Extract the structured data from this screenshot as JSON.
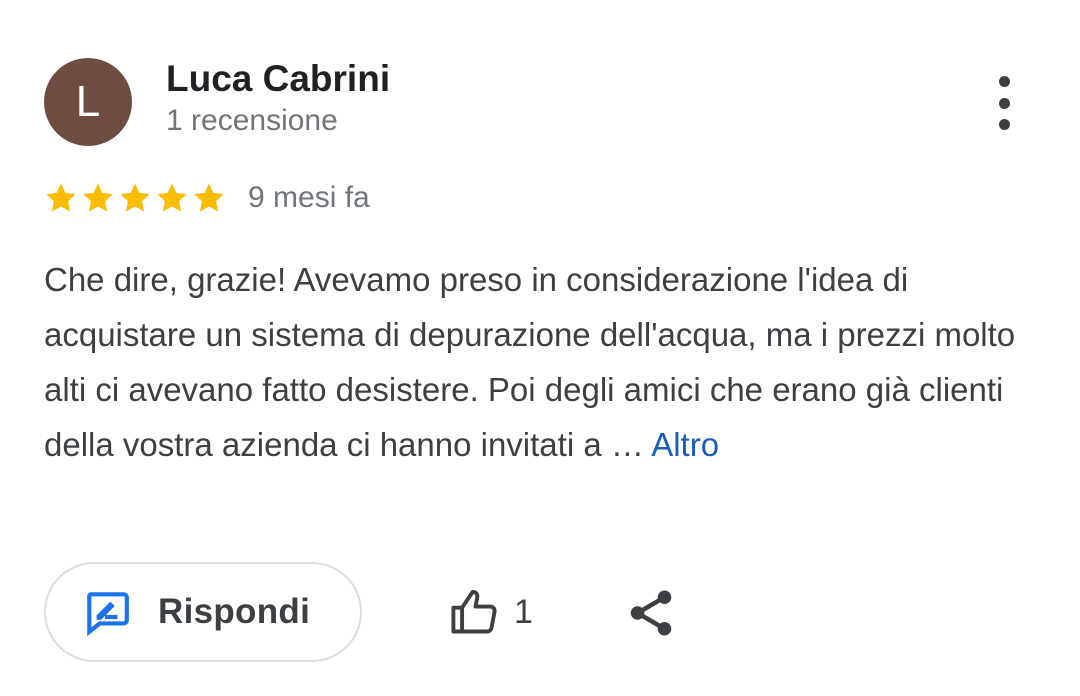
{
  "reviewer": {
    "initial": "L",
    "name": "Luca Cabrini",
    "review_count": "1 recensione",
    "avatar_color": "#6d4c41"
  },
  "review": {
    "rating": 5,
    "rating_max": 5,
    "star_color": "#fbbc04",
    "time_ago": "9 mesi fa",
    "text": "Che dire, grazie! Avevamo preso in considerazione l'idea di acquistare un sistema di depurazione dell'acqua, ma i prezzi molto alti ci avevano fatto desistere. Poi degli amici che erano già clienti della vostra azienda ci hanno invitati a … ",
    "more_label": "Altro",
    "link_color": "#1a5fb4"
  },
  "actions": {
    "reply_label": "Rispondi",
    "reply_icon": "rate-review-icon",
    "like_icon": "thumb-up-icon",
    "like_count": "1",
    "share_icon": "share-icon",
    "menu_icon": "more-vert-icon",
    "accent_color": "#1a73e8"
  }
}
